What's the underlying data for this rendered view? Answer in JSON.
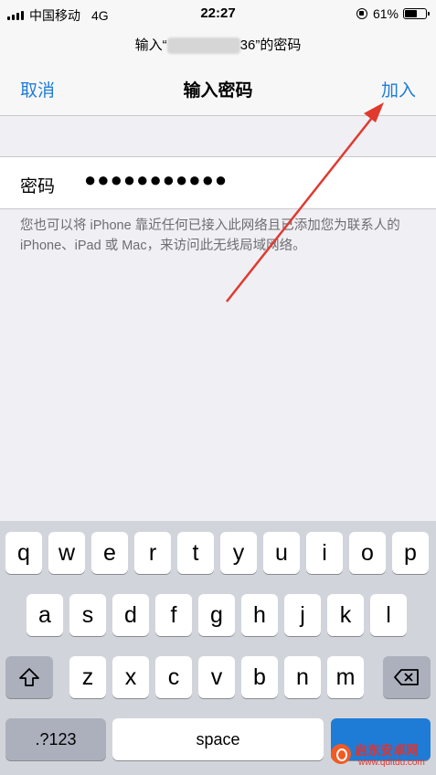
{
  "status_bar": {
    "carrier": "中国移动",
    "network": "4G",
    "time": "22:27",
    "battery": "61%",
    "battery_level": 0.61
  },
  "prompt": {
    "prefix": "输入“",
    "suffix": "36”的密码"
  },
  "nav": {
    "cancel": "取消",
    "title": "输入密码",
    "join": "加入"
  },
  "password": {
    "label": "密码",
    "value": "●●●●●●●●●●●"
  },
  "footnote": "您也可以将 iPhone 靠近任何已接入此网络且已添加您为联系人的 iPhone、iPad 或 Mac，来访问此无线局域网络。",
  "keyboard": {
    "row1": [
      "q",
      "w",
      "e",
      "r",
      "t",
      "y",
      "u",
      "i",
      "o",
      "p"
    ],
    "row2": [
      "a",
      "s",
      "d",
      "f",
      "g",
      "h",
      "j",
      "k",
      "l"
    ],
    "row3": [
      "z",
      "x",
      "c",
      "v",
      "b",
      "n",
      "m"
    ],
    "numbers_key": ".?123",
    "space_key": "space"
  },
  "watermark": {
    "name": "启东安卓网",
    "url": "www.qdltdu.com"
  },
  "colors": {
    "accent": "#1e7cd6",
    "annotation_arrow": "#e03a2f"
  }
}
